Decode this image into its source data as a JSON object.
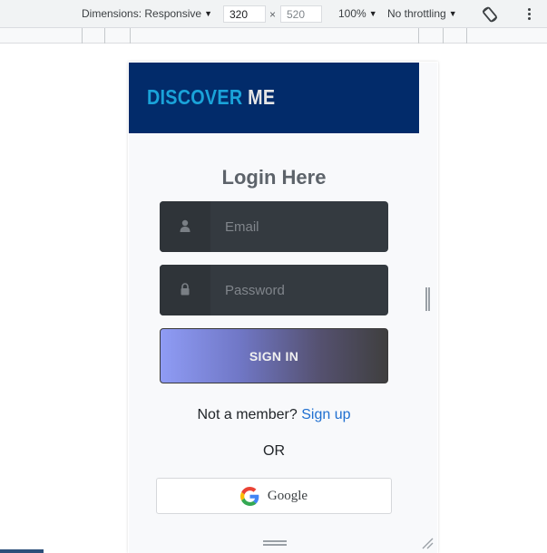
{
  "devtools": {
    "dimensions_label": "Dimensions: Responsive",
    "width_value": "320",
    "height_value": "520",
    "zoom_label": "100%",
    "throttling_label": "No throttling",
    "rotate_icon": "rotate-icon",
    "more_icon": "more-vert-icon"
  },
  "header": {
    "brand_part1": "DISCOVER",
    "brand_part2": "ME",
    "brand_color1": "#1aa3d9",
    "brand_color2": "#e6e6e6",
    "background": "#022b6a"
  },
  "login": {
    "title": "Login Here",
    "email_placeholder": "Email",
    "email_icon": "user-icon",
    "password_placeholder": "Password",
    "password_icon": "lock-icon",
    "signin_label": "SIGN IN",
    "member_text": "Not a member?",
    "signup_link": "Sign up",
    "or_text": "OR",
    "google_label": "Google",
    "google_icon": "google-icon"
  }
}
